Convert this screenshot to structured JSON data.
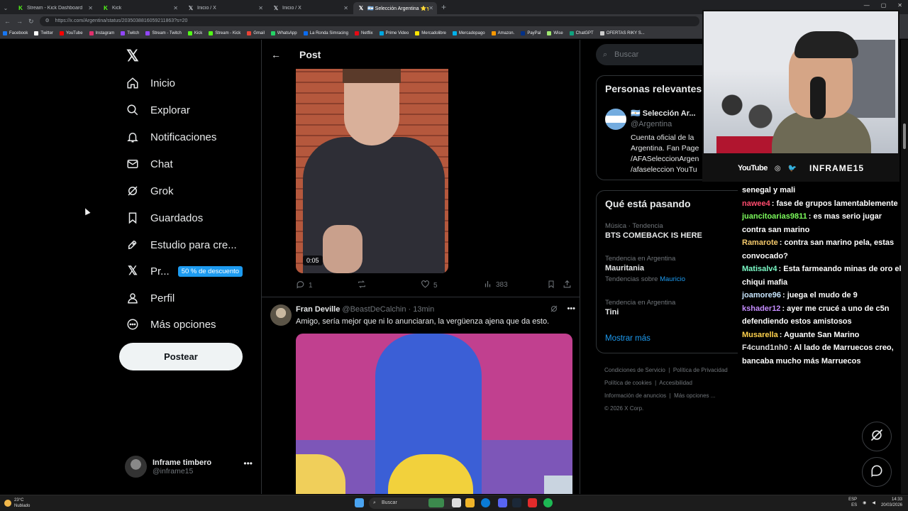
{
  "browser": {
    "tabs": [
      {
        "label": "Stream - Kick Dashboard",
        "favicon": "kick-icon",
        "active": false
      },
      {
        "label": "Kick",
        "favicon": "kick-icon",
        "active": false
      },
      {
        "label": "Inicio / X",
        "favicon": "x-icon",
        "active": false
      },
      {
        "label": "Inicio / X",
        "favicon": "x-icon",
        "active": false
      },
      {
        "label": "🇦🇷 Selección Argentina ⭐⭐⭐",
        "favicon": "x-icon",
        "active": true
      }
    ],
    "new_tab": "+",
    "url": "https://x.com/Argentina/status/2035038816059211863?s=20",
    "bookmarks": [
      {
        "label": "Facebook",
        "color": "#1877f2"
      },
      {
        "label": "Twitter",
        "color": "#ffffff"
      },
      {
        "label": "YouTube",
        "color": "#ff0000"
      },
      {
        "label": "Instagram",
        "color": "#e1306c"
      },
      {
        "label": "Twitch",
        "color": "#9146ff"
      },
      {
        "label": "Stream - Twitch",
        "color": "#9146ff"
      },
      {
        "label": "Kick",
        "color": "#53fc18"
      },
      {
        "label": "Stream - Kick",
        "color": "#53fc18"
      },
      {
        "label": "Gmail",
        "color": "#ea4335"
      },
      {
        "label": "WhatsApp",
        "color": "#25d366"
      },
      {
        "label": "La Ronda Simracing",
        "color": "#0b6cf0"
      },
      {
        "label": "Netflix",
        "color": "#e50914"
      },
      {
        "label": "Prime Video",
        "color": "#00a8e1"
      },
      {
        "label": "Mercadolibre",
        "color": "#ffe600"
      },
      {
        "label": "Mercadopago",
        "color": "#00b1ea"
      },
      {
        "label": "Amazon.",
        "color": "#ff9900"
      },
      {
        "label": "PayPal",
        "color": "#003087"
      },
      {
        "label": "Wise",
        "color": "#9fe870"
      },
      {
        "label": "ChatGPT",
        "color": "#10a37f"
      },
      {
        "label": "OFERTAS RIKY S...",
        "color": "#cccccc"
      }
    ]
  },
  "nav": {
    "items": [
      {
        "label": "Inicio",
        "icon": "home-icon"
      },
      {
        "label": "Explorar",
        "icon": "search-icon"
      },
      {
        "label": "Notificaciones",
        "icon": "bell-icon"
      },
      {
        "label": "Chat",
        "icon": "mail-icon"
      },
      {
        "label": "Grok",
        "icon": "grok-icon"
      },
      {
        "label": "Guardados",
        "icon": "bookmark-icon"
      },
      {
        "label": "Estudio para cre...",
        "icon": "rocket-icon"
      },
      {
        "label": "Pr...",
        "icon": "x-icon"
      },
      {
        "label": "Perfil",
        "icon": "person-icon"
      },
      {
        "label": "Más opciones",
        "icon": "more-circle-icon"
      }
    ],
    "premium_badge": "50 % de descuento",
    "post_button": "Postear",
    "account": {
      "name": "Inframe timbero",
      "handle": "@inframe15"
    }
  },
  "post": {
    "header_title": "Post",
    "video_time": "0:05",
    "stats": {
      "replies": "1",
      "retweets": "",
      "likes": "5",
      "views": "383"
    },
    "reply": {
      "name": "Fran Deville",
      "handle": "@BeastDeCalchin",
      "time": "13min",
      "text": "Amigo, sería mejor que ni lo anunciaran, la vergüenza ajena que da esto."
    }
  },
  "sidebar": {
    "search_placeholder": "Buscar",
    "relevant_title": "Personas relevantes",
    "relevant_person": {
      "name": "🇦🇷 Selección Ar...",
      "handle": "@Argentina",
      "bio": "Cuenta oficial de la Argentina. Fan Page /AFASeleccionArgen /afaseleccion YouTu"
    },
    "trends_title": "Qué está pasando",
    "trends": [
      {
        "context": "Música · Tendencia",
        "name": "BTS COMEBACK IS HERE",
        "sub": "",
        "sub_link": ""
      },
      {
        "context": "Tendencia en Argentina",
        "name": "Mauritania",
        "sub": "Tendencias sobre",
        "sub_link": "Mauricio"
      },
      {
        "context": "Tendencia en Argentina",
        "name": "Tini",
        "sub": "",
        "sub_link": ""
      }
    ],
    "show_more": "Mostrar más",
    "footer": [
      "Condiciones de Servicio",
      "|",
      "Política de Privacidad",
      "Política de cookies",
      "|",
      "Accesibilidad",
      "Información de anuncios",
      "|",
      "Más opciones ...",
      "© 2026 X Corp."
    ]
  },
  "overlay": {
    "socials": {
      "youtube": "YouTube",
      "brand": "INFRAME15"
    },
    "chat": [
      {
        "user": "",
        "color": "#ffffff",
        "text": "senegal y mali"
      },
      {
        "user": "nawee4",
        "color": "#ff4b6e",
        "text": ": fase de grupos lamentablemente"
      },
      {
        "user": "juancitoarias9811",
        "color": "#7cfc5c",
        "text": ": es mas serio jugar contra san marino"
      },
      {
        "user": "Ramarote",
        "color": "#f5c96b",
        "text": ": contra san marino pela, estas convocado?"
      },
      {
        "user": "Matisalv4",
        "color": "#7cfcc8",
        "text": ": Esta farmeando minas de oro el chiqui mafia"
      },
      {
        "user": "joamore96",
        "color": "#c8e6ff",
        "text": ": juega el mudo de 9"
      },
      {
        "user": "kshader12",
        "color": "#c58cff",
        "text": ": ayer me crucé a uno de c5n defendiendo estos amistosos"
      },
      {
        "user": "Musarella",
        "color": "#ffd24d",
        "text": ": Aguante San Marino"
      },
      {
        "user": "F4cund1nh0",
        "color": "#dddddd",
        "text": ": Al lado de Marruecos creo, bancaba mucho más Marruecos"
      }
    ]
  },
  "taskbar": {
    "weather_temp": "23°C",
    "weather_desc": "Nublado",
    "search": "Buscar",
    "lang": "ESP",
    "lang2": "ES",
    "time": "14:33",
    "date": "20/03/2026"
  }
}
